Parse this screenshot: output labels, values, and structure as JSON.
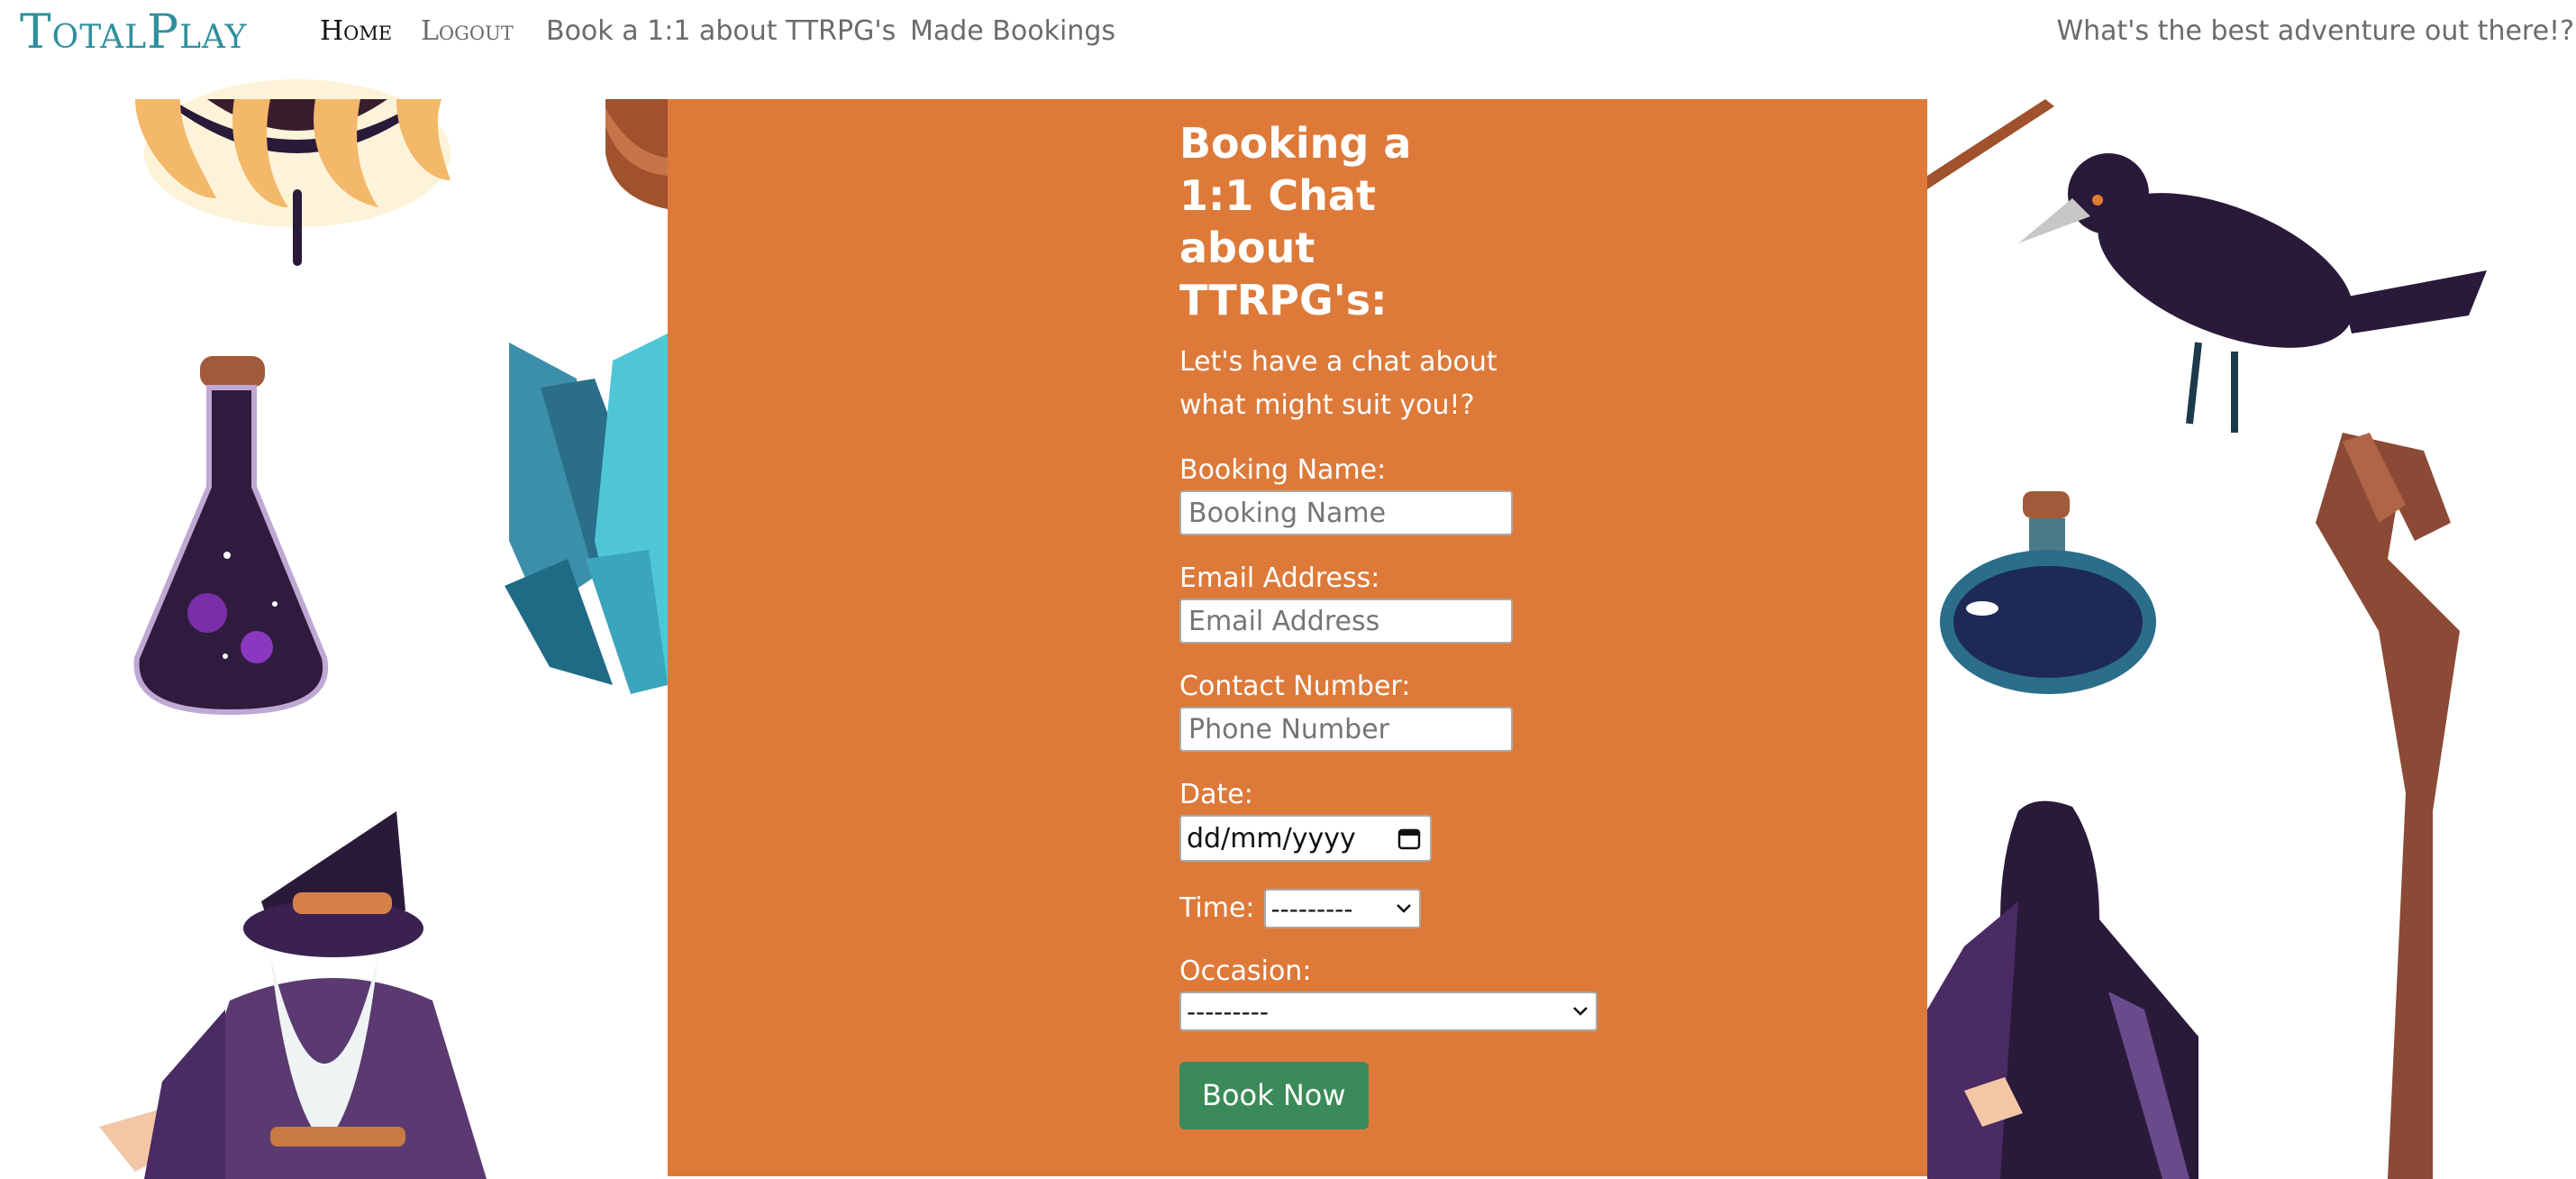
{
  "navbar": {
    "brand": "TotalPlay",
    "links": [
      "Home",
      "Logout",
      "Book a 1:1 about TTRPG's",
      "Made Bookings"
    ],
    "tagline": "What's the best adventure out there!?"
  },
  "form": {
    "title": "Booking a 1:1 Chat about TTRPG's:",
    "intro": "Let's have a chat about what might suit you!?",
    "booking_name_label": "Booking Name:",
    "booking_name_placeholder": "Booking Name",
    "email_label": "Email Address:",
    "email_placeholder": "Email Address",
    "contact_label": "Contact Number:",
    "contact_placeholder": "Phone Number",
    "date_label": "Date:",
    "date_value": "dd/mm/yyyy",
    "time_label": "Time:",
    "time_value": "---------",
    "occasion_label": "Occasion:",
    "occasion_value": "---------",
    "submit_label": "Book Now"
  },
  "colors": {
    "brand": "#2f8f9d",
    "panel": "#dd7a3a",
    "button": "#3b8a5a"
  },
  "icons": {
    "date_picker": "calendar-icon",
    "select_arrow": "chevron-down-icon"
  }
}
